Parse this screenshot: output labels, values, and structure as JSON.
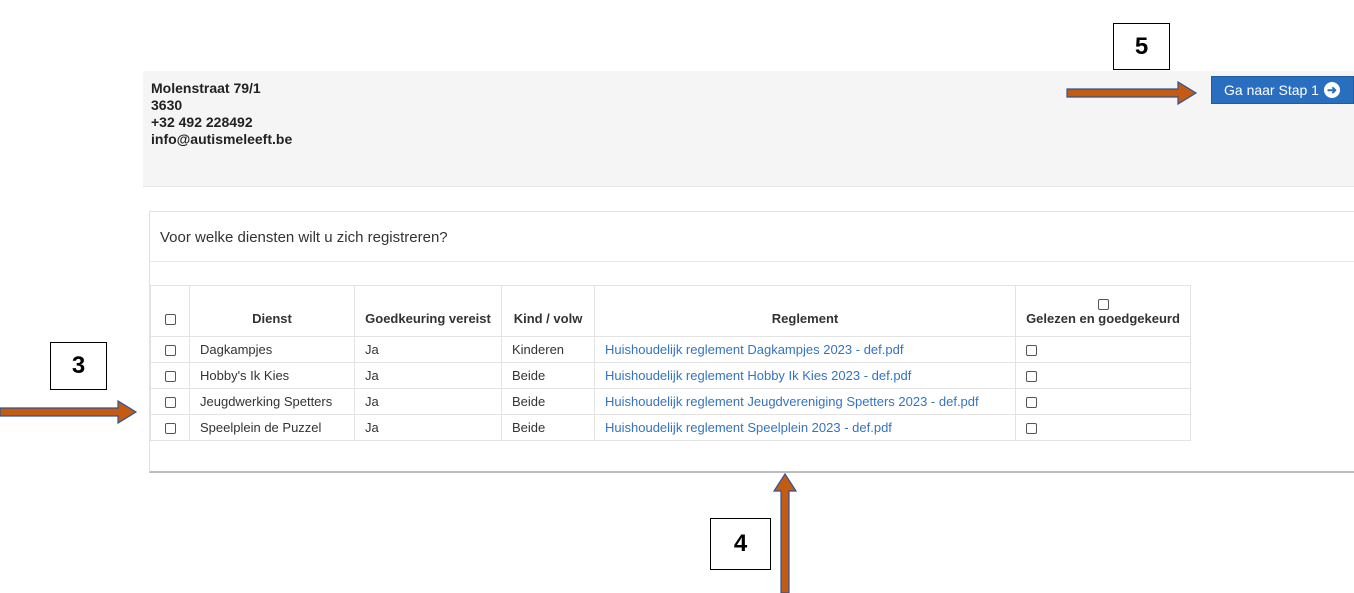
{
  "contact": {
    "street": "Molenstraat 79/1",
    "postcode": "3630",
    "phone": "+32 492 228492",
    "email": "info@autismeleeft.be"
  },
  "next_button": {
    "label": "Ga naar Stap 1",
    "icon": "arrow-circle-right-icon",
    "glyph": "➜",
    "color": "#2a6fbf"
  },
  "panel": {
    "question": "Voor welke diensten wilt u zich registreren?"
  },
  "table": {
    "headers": {
      "dienst": "Dienst",
      "goedkeuring": "Goedkeuring vereist",
      "kind": "Kind / volw",
      "reglement": "Reglement",
      "gelezen": "Gelezen en goedgekeurd"
    },
    "rows": [
      {
        "dienst": "Dagkampjes",
        "goedkeuring": "Ja",
        "kind": "Kinderen",
        "reglement": "Huishoudelijk reglement Dagkampjes 2023 - def.pdf"
      },
      {
        "dienst": "Hobby's Ik Kies",
        "goedkeuring": "Ja",
        "kind": "Beide",
        "reglement": "Huishoudelijk reglement Hobby Ik Kies 2023 - def.pdf"
      },
      {
        "dienst": "Jeugdwerking Spetters",
        "goedkeuring": "Ja",
        "kind": "Beide",
        "reglement": "Huishoudelijk reglement Jeugdvereniging Spetters 2023 - def.pdf"
      },
      {
        "dienst": "Speelplein de Puzzel",
        "goedkeuring": "Ja",
        "kind": "Beide",
        "reglement": "Huishoudelijk reglement Speelplein 2023 - def.pdf"
      }
    ],
    "link_color": "#3473c4"
  },
  "annotations": {
    "callout_3": "3",
    "callout_4": "4",
    "callout_5": "5",
    "arrow_color": "#c55a11",
    "arrow_outline": "#2f5597"
  }
}
